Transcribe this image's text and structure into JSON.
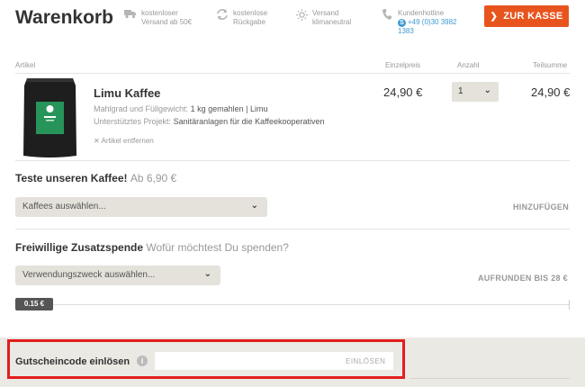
{
  "header": {
    "title": "Warenkorb",
    "features": [
      {
        "icon": "truck-icon",
        "line1": "kostenloser",
        "line2": "Versand ab 50€"
      },
      {
        "icon": "return-arrows-icon",
        "line1": "kostenlose",
        "line2": "Rückgabe"
      },
      {
        "icon": "sun-icon",
        "line1": "Versand",
        "line2": "klimaneutral"
      }
    ],
    "hotline": {
      "label": "Kundenhotline",
      "phone_line1": "+49 (0)30 3982",
      "phone_line2": "1383"
    },
    "checkout_label": "ZUR KASSE",
    "accent_color": "#e8541e"
  },
  "table": {
    "columns": {
      "artikel": "Artikel",
      "einzelpreis": "Einzelpreis",
      "anzahl": "Anzahl",
      "teilsumme": "Teilsumme"
    }
  },
  "item": {
    "name": "Limu Kaffee",
    "grind_label": "Mahlgrad und Füllgewicht:",
    "grind_value": "1 kg gemahlen | Limu",
    "project_label": "Unterstütztes Projekt:",
    "project_value": "Sanitäranlagen für die Kaffeekooperativen",
    "remove_label": "Artikel entfernen",
    "unit_price": "24,90 €",
    "quantity": "1",
    "subtotal": "24,90 €"
  },
  "try_coffee": {
    "title": "Teste unseren Kaffee!",
    "subtitle": "Ab 6,90 €",
    "select_value": "Kaffees auswählen...",
    "action": "HINZUFÜGEN"
  },
  "donation": {
    "title": "Freiwillige Zusatzspende",
    "subtitle": "Wofür möchtest Du spenden?",
    "select_value": "Verwendungszweck auswählen...",
    "action": "AUFRUNDEN BIS 28 €",
    "slider_value": "0.15 €"
  },
  "voucher": {
    "label": "Gutscheincode einlösen",
    "info": "i",
    "submit": "EINLÖSEN",
    "placeholder": ""
  }
}
